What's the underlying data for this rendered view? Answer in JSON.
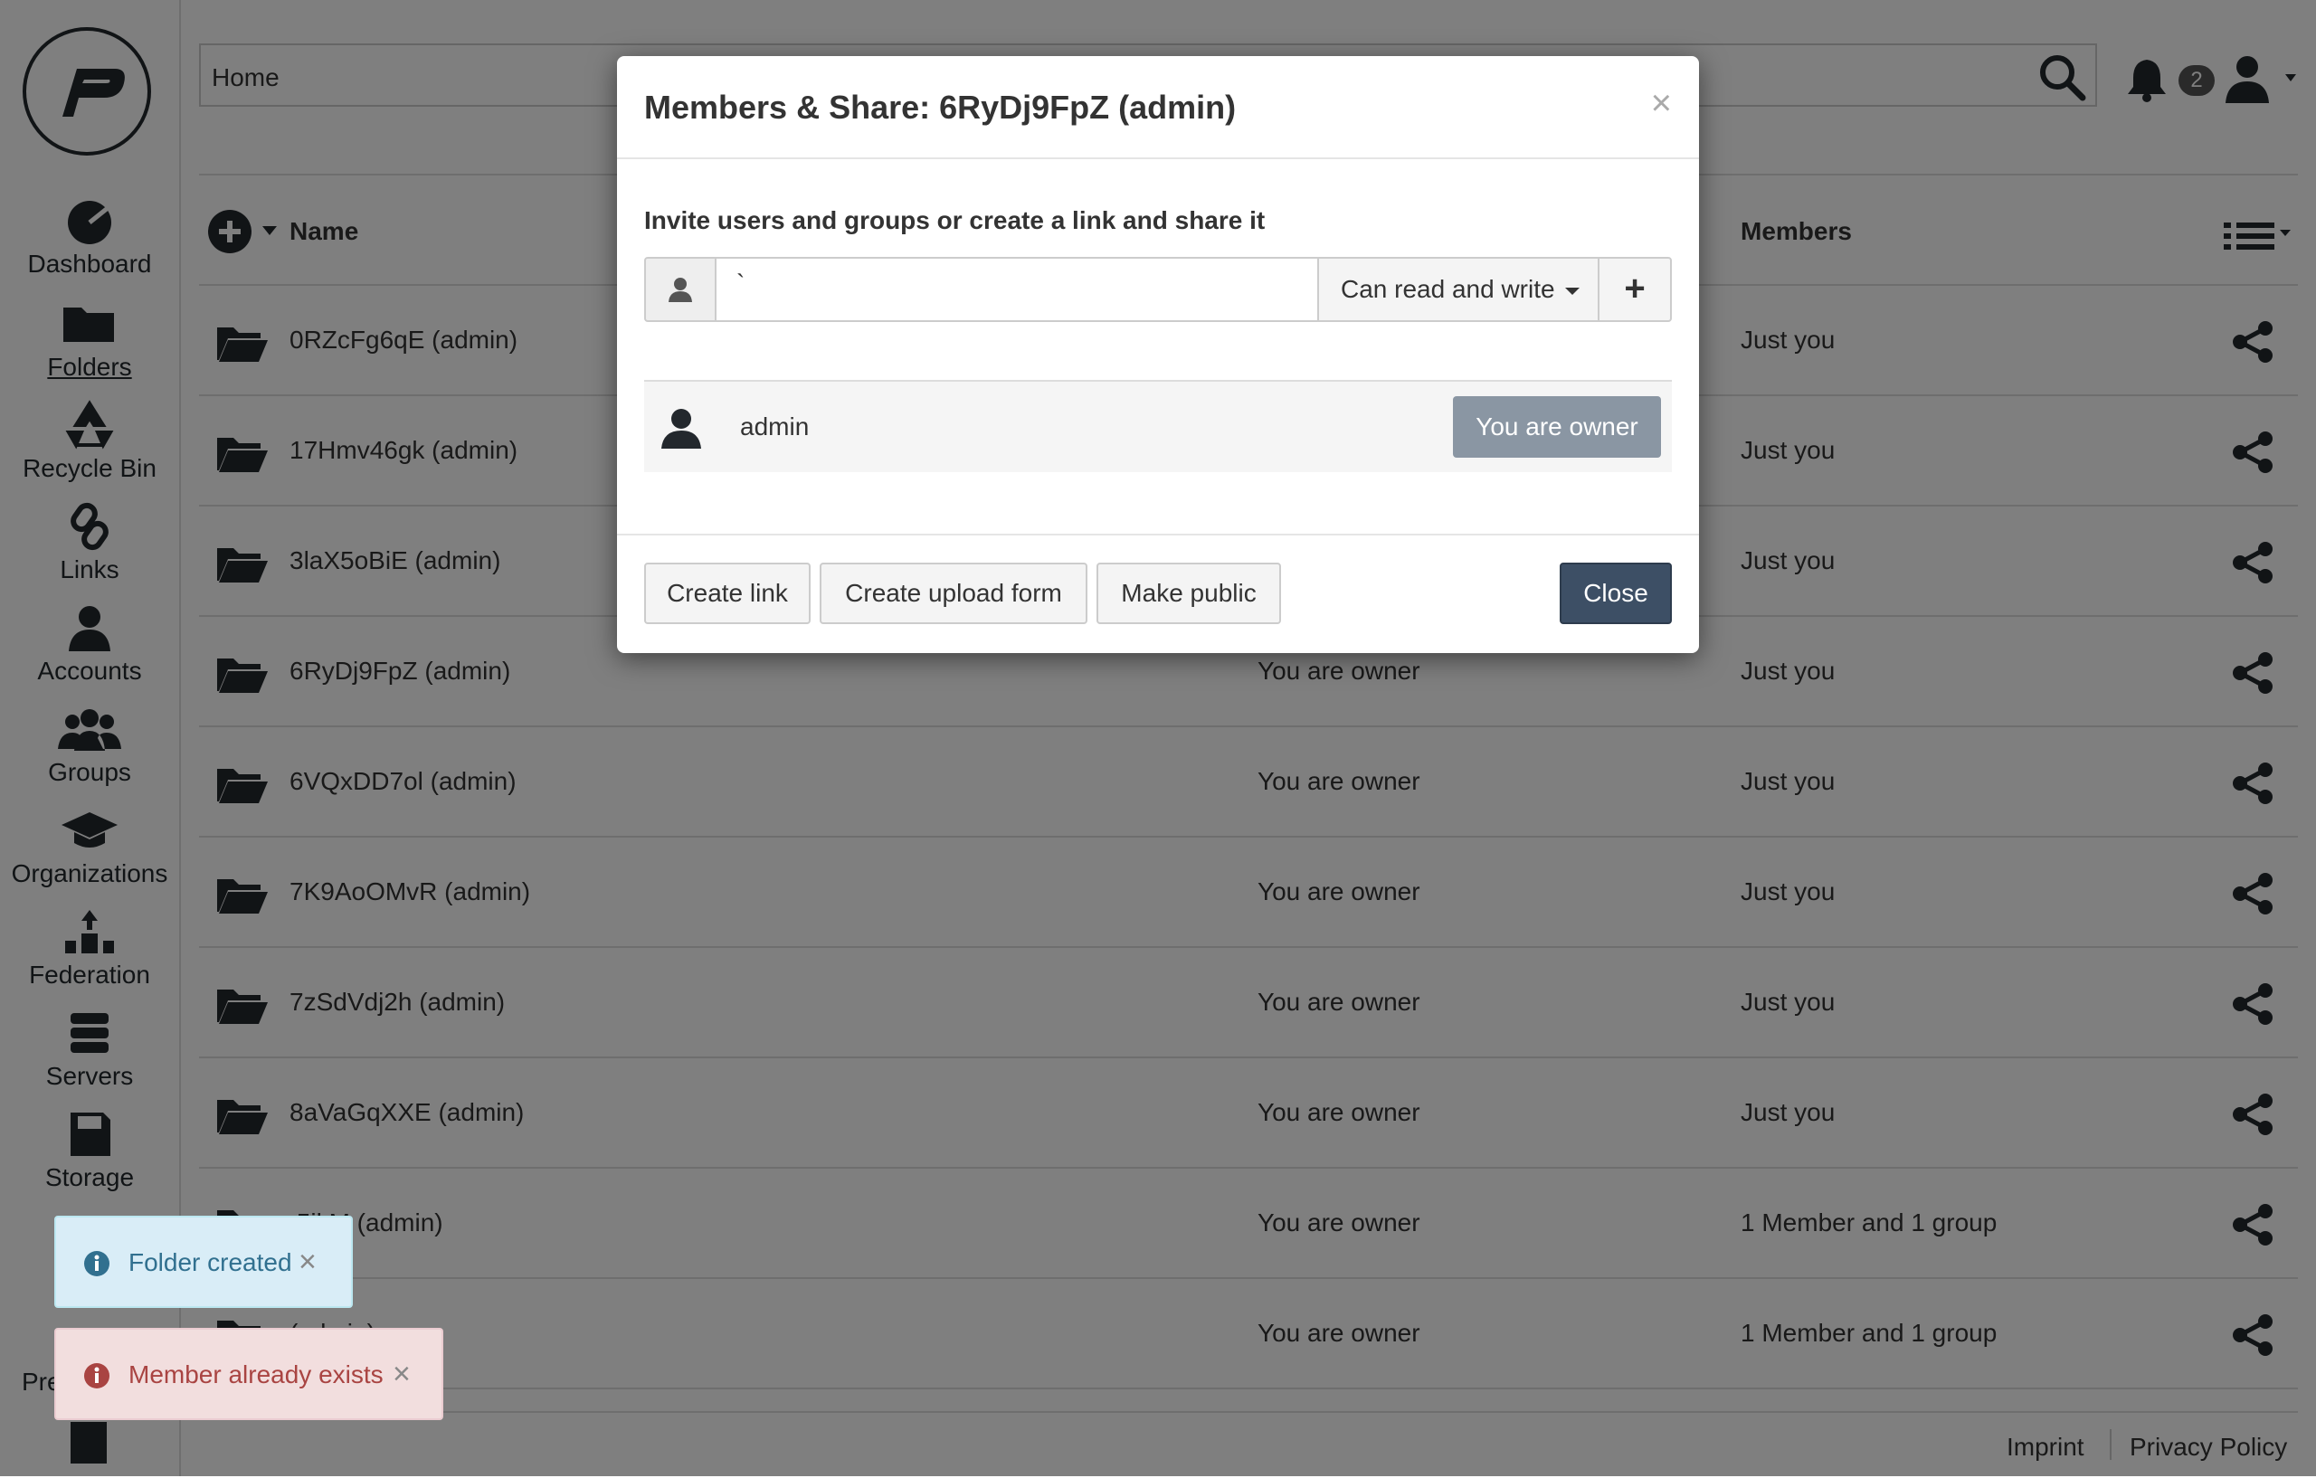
{
  "sidebar": {
    "items": [
      {
        "label": "Dashboard",
        "icon": "dashboard-icon"
      },
      {
        "label": "Folders",
        "icon": "folder-icon"
      },
      {
        "label": "Recycle Bin",
        "icon": "recycle-icon"
      },
      {
        "label": "Links",
        "icon": "link-icon"
      },
      {
        "label": "Accounts",
        "icon": "user-icon"
      },
      {
        "label": "Groups",
        "icon": "group-icon"
      },
      {
        "label": "Organizations",
        "icon": "graduation-cap-icon"
      },
      {
        "label": "Federation",
        "icon": "federation-icon"
      },
      {
        "label": "Servers",
        "icon": "server-icon"
      },
      {
        "label": "Storage",
        "icon": "floppy-icon"
      }
    ],
    "partial_label": "Pre"
  },
  "topbar": {
    "breadcrumb": "Home",
    "notification_count": "2"
  },
  "table": {
    "headers": {
      "name": "Name",
      "members": "Members"
    },
    "rows": [
      {
        "name": "0RZcFg6qE (admin)",
        "owner": "",
        "members": "Just you"
      },
      {
        "name": "17Hmv46gk (admin)",
        "owner": "",
        "members": "Just you"
      },
      {
        "name": "3laX5oBiE (admin)",
        "owner": "",
        "members": "Just you"
      },
      {
        "name": "6RyDj9FpZ (admin)",
        "owner": "You are owner",
        "members": "Just you"
      },
      {
        "name": "6VQxDD7ol (admin)",
        "owner": "You are owner",
        "members": "Just you"
      },
      {
        "name": "7K9AoOMvR (admin)",
        "owner": "You are owner",
        "members": "Just you"
      },
      {
        "name": "7zSdVdj2h (admin)",
        "owner": "You are owner",
        "members": "Just you"
      },
      {
        "name": "8aVaGqXXE (admin)",
        "owner": "You are owner",
        "members": "Just you"
      },
      {
        "name": ".5jkM (admin)",
        "owner": "You are owner",
        "members": "1 Member and 1 group"
      },
      {
        "name": "(admin)",
        "owner": "You are owner",
        "members": "1 Member and 1 group"
      }
    ]
  },
  "footer": {
    "imprint": "Imprint",
    "privacy": "Privacy Policy"
  },
  "modal": {
    "title": "Members & Share: 6RyDj9FpZ (admin)",
    "close_x": "×",
    "invite_label": "Invite users and groups or create a link and share it",
    "input_value": "`",
    "permission": "Can read and write",
    "add_button": "+",
    "member_name": "admin",
    "owner_badge": "You are owner",
    "buttons": {
      "create_link": "Create link",
      "create_upload_form": "Create upload form",
      "make_public": "Make public",
      "close": "Close"
    }
  },
  "toasts": [
    {
      "text": "Folder created",
      "type": "info"
    },
    {
      "text": "Member already exists",
      "type": "error"
    }
  ],
  "colors": {
    "primary": "#3d4f65",
    "badge": "#8a96a3",
    "info": "#d9edf7",
    "error": "#f2dede"
  }
}
